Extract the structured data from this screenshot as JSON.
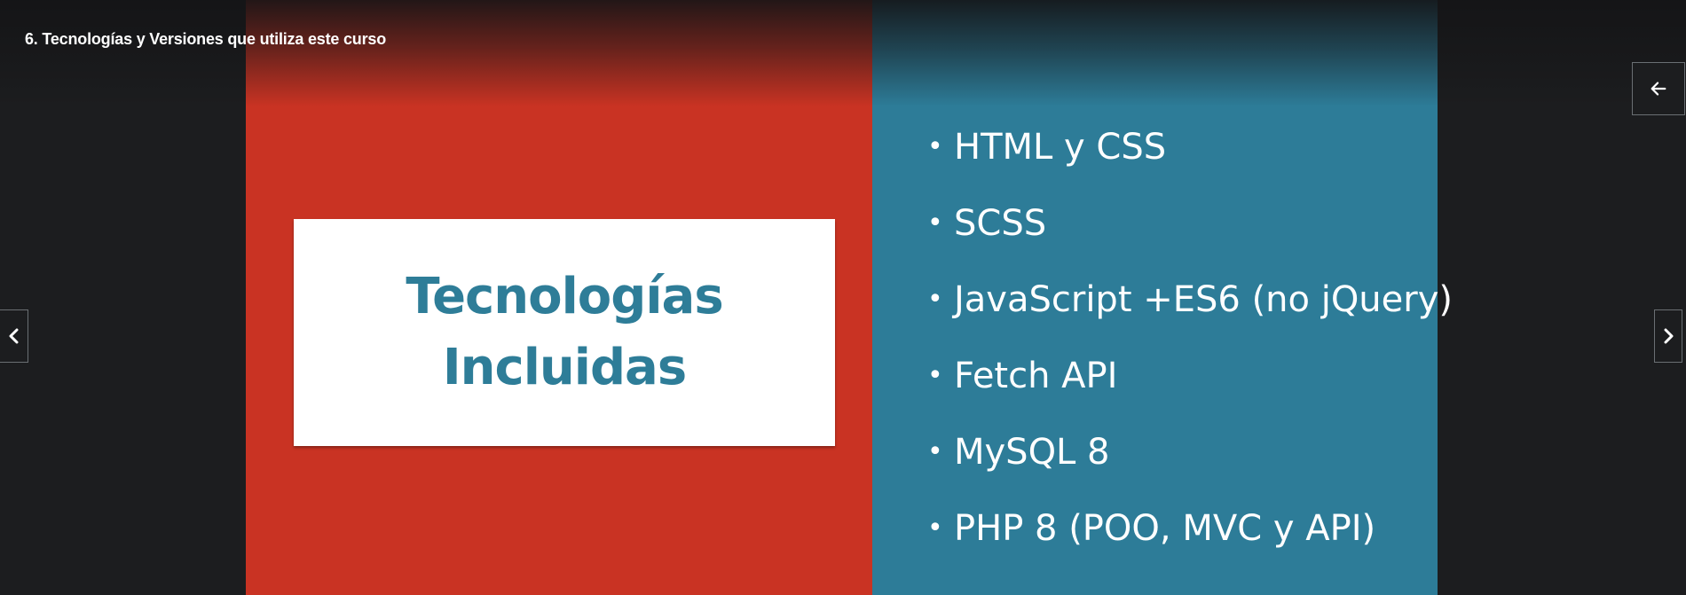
{
  "lecture": {
    "title": "6. Tecnologías y Versiones que utiliza este curso"
  },
  "slide": {
    "card_title_line1": "Tecnologías",
    "card_title_line2": "Incluidas",
    "bullet_char": "•",
    "technologies": [
      "HTML y CSS",
      "SCSS",
      "JavaScript +ES6 (no jQuery)",
      "Fetch API",
      "MySQL 8",
      "PHP 8 (POO, MVC y API)"
    ]
  },
  "controls": {
    "sidebar_toggle_icon": "arrow-left-icon",
    "prev_icon": "chevron-left-icon",
    "next_icon": "chevron-right-icon"
  },
  "colors": {
    "player_bg": "#1c1d1f",
    "slide_red": "#c93323",
    "slide_blue": "#2d7c98",
    "card_text": "#2e7d98"
  }
}
